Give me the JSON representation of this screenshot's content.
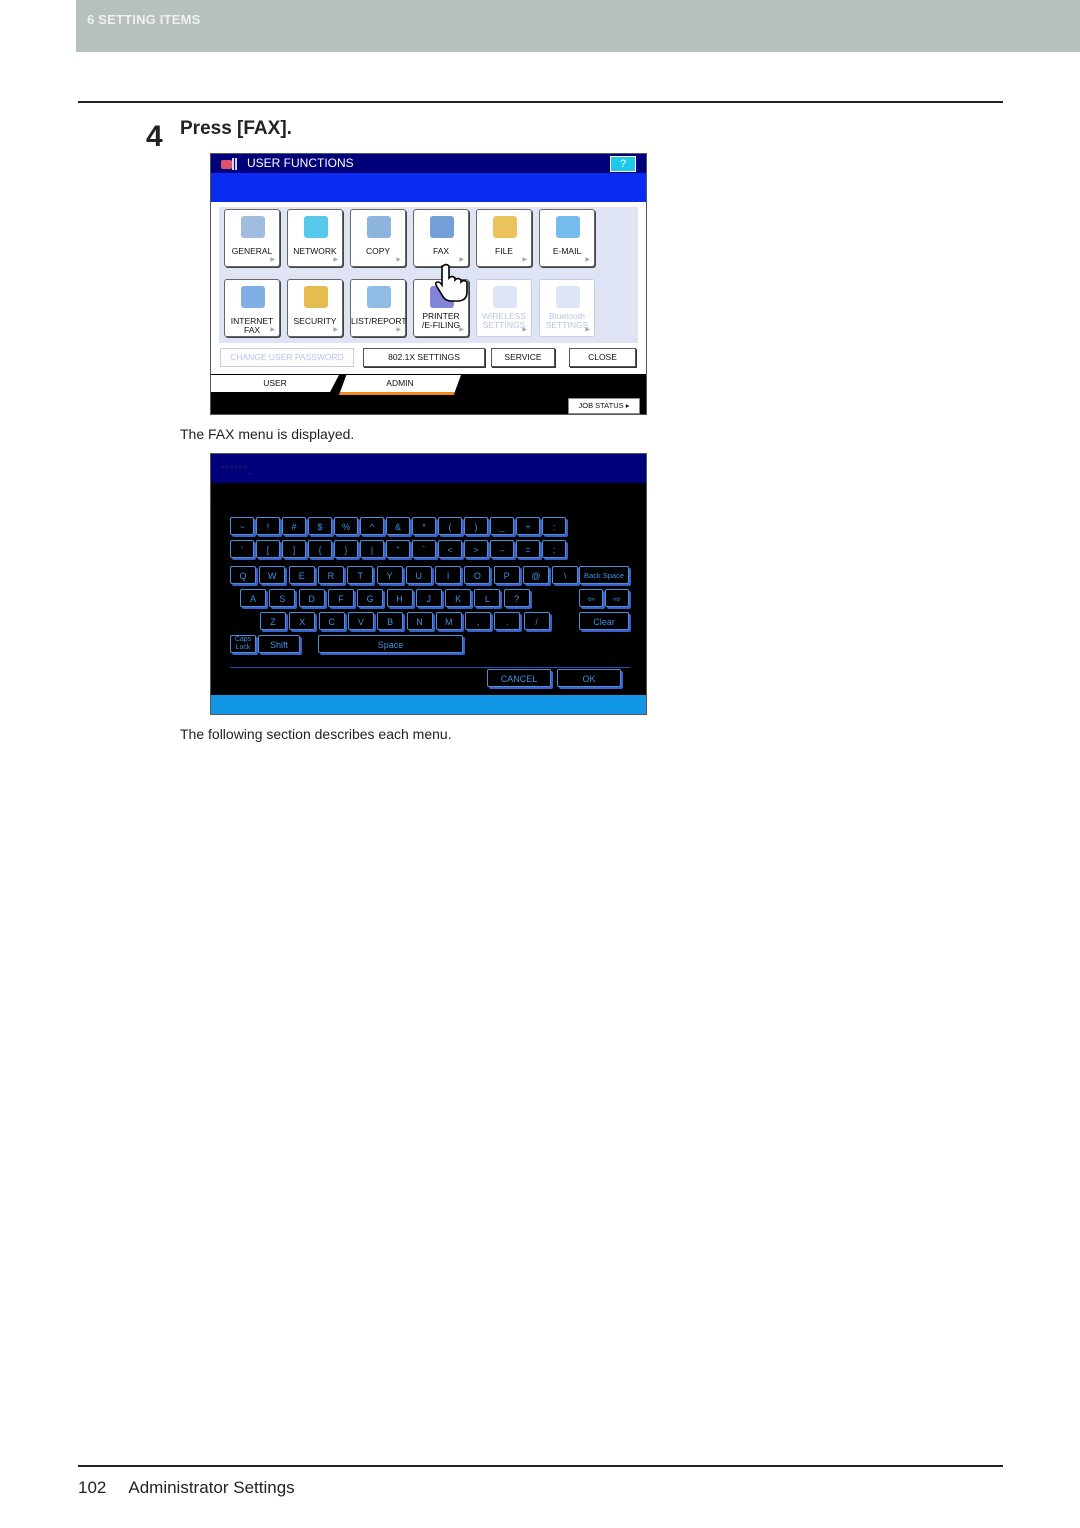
{
  "header": {
    "section": "6 SETTING ITEMS"
  },
  "step": {
    "number": "4",
    "title": "Press [FAX]."
  },
  "captions": {
    "after_screen1": "The FAX menu is displayed.",
    "after_screen2": "The following section describes each menu."
  },
  "footer": {
    "page": "102",
    "title": "Administrator Settings"
  },
  "screen1": {
    "title": "USER FUNCTIONS",
    "help_label": "?",
    "function_buttons": [
      {
        "label": "GENERAL",
        "icon": "copier-icon",
        "enabled": true
      },
      {
        "label": "NETWORK",
        "icon": "network-icon",
        "enabled": true
      },
      {
        "label": "COPY",
        "icon": "copy-icon",
        "enabled": true
      },
      {
        "label": "FAX",
        "icon": "fax-icon",
        "enabled": true
      },
      {
        "label": "FILE",
        "icon": "scan-to-folder-icon",
        "enabled": true
      },
      {
        "label": "E-MAIL",
        "icon": "email-icon",
        "enabled": true
      },
      {
        "label": "INTERNET FAX",
        "icon": "internet-fax-icon",
        "enabled": true
      },
      {
        "label": "SECURITY",
        "icon": "security-icon",
        "enabled": true
      },
      {
        "label": "LIST/REPORT",
        "icon": "report-icon",
        "enabled": true
      },
      {
        "label": "PRINTER /E-FILING",
        "icon": "printer-icon",
        "enabled": true
      },
      {
        "label": "WIRELESS SETTINGS",
        "icon": "wireless-icon",
        "enabled": false
      },
      {
        "label": "Bluetooth SETTINGS",
        "icon": "bluetooth-icon",
        "enabled": false
      }
    ],
    "wide_buttons": [
      {
        "label": "CHANGE USER PASSWORD",
        "enabled": false
      },
      {
        "label": "802.1X SETTINGS",
        "enabled": true
      },
      {
        "label": "SERVICE",
        "enabled": true
      },
      {
        "label": "CLOSE",
        "enabled": true
      }
    ],
    "tabs": [
      {
        "label": "USER"
      },
      {
        "label": "ADMIN",
        "active": true
      }
    ],
    "job_status_label": "JOB STATUS",
    "pointer": "hand-pointer-icon"
  },
  "screen2": {
    "password_mask": "******_",
    "rows": [
      [
        "~",
        "!",
        "#",
        "$",
        "%",
        "^",
        "&",
        "*",
        "(",
        ")",
        "_",
        "+",
        ":"
      ],
      [
        "'",
        "[",
        "]",
        "{",
        "}",
        "|",
        "\"",
        "`",
        "<",
        ">",
        "–",
        "=",
        ";"
      ],
      [
        "Q",
        "W",
        "E",
        "R",
        "T",
        "Y",
        "U",
        "I",
        "O",
        "P",
        "@",
        "\\"
      ],
      [
        "A",
        "S",
        "D",
        "F",
        "G",
        "H",
        "J",
        "K",
        "L",
        "?"
      ],
      [
        "Z",
        "X",
        "C",
        "V",
        "B",
        "N",
        "M",
        ",",
        ".",
        "/"
      ]
    ],
    "special": {
      "backspace": "Back Space",
      "left_arrow": "⇦",
      "right_arrow": "⇨",
      "clear": "Clear",
      "caps_lock": "Caps Lock",
      "shift": "Shift",
      "space": "Space",
      "cancel": "CANCEL",
      "ok": "OK"
    }
  }
}
